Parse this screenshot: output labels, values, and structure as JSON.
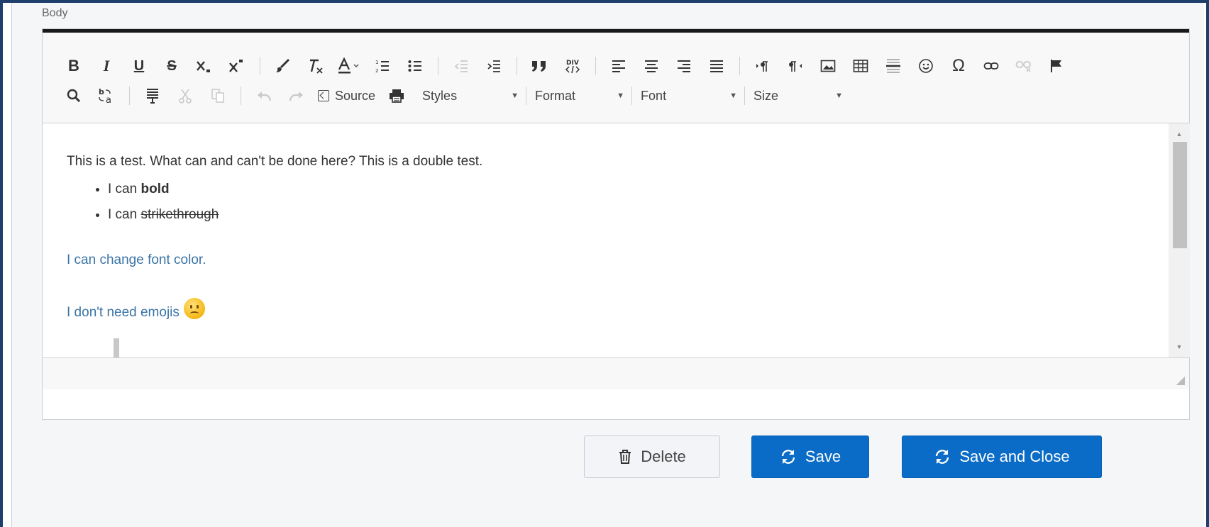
{
  "field": {
    "label": "Body"
  },
  "toolbar": {
    "row1": [
      "bold",
      "italic",
      "underline",
      "strikethrough",
      "subscript",
      "superscript",
      "copy-formatting",
      "remove-format",
      "text-color",
      "numbered-list",
      "bulleted-list",
      "decrease-indent",
      "increase-indent",
      "blockquote",
      "create-div",
      "align-left",
      "align-center",
      "align-right",
      "justify",
      "ltr",
      "rtl",
      "image",
      "table",
      "horizontal-line",
      "smiley",
      "special-char",
      "link",
      "unlink",
      "anchor"
    ],
    "row2": [
      "find",
      "replace",
      "select-all",
      "cut",
      "copy",
      "undo",
      "redo",
      "source",
      "print"
    ],
    "bold_glyph": "B",
    "italic_glyph": "I",
    "underline_glyph": "U",
    "strike_glyph": "S",
    "source_label": "Source",
    "styles_label": "Styles",
    "format_label": "Format",
    "font_label": "Font",
    "size_label": "Size"
  },
  "content": {
    "paragraph1": "This is a test. What can and can't be done here? This is a double test.",
    "list_item1_prefix": "I can ",
    "list_item1_bold": "bold",
    "list_item2_prefix": "I can ",
    "list_item2_strike": "strikethrough",
    "color_line": "I can change font color.",
    "emoji_line": "I don't need emojis",
    "emoji_name": "sad-face-emoji",
    "link_color": "#3a74a6"
  },
  "buttons": {
    "delete": "Delete",
    "save": "Save",
    "save_close": "Save and Close",
    "accent": "#0a6cc7"
  }
}
